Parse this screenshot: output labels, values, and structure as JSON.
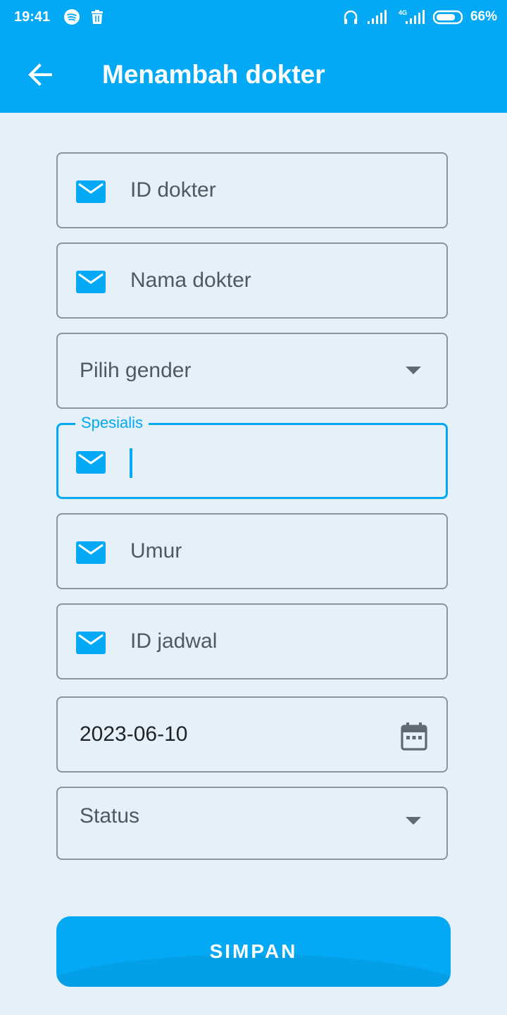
{
  "status_bar": {
    "time": "19:41",
    "battery": "66%",
    "icons": [
      "spotify-icon",
      "trash-icon",
      "headphones-icon",
      "signal-icon",
      "signal-4g-icon",
      "battery-icon"
    ]
  },
  "app_bar": {
    "title": "Menambah dokter",
    "back_icon": "arrow-back-icon",
    "color": "#03a9f4"
  },
  "form": {
    "id_dokter": {
      "placeholder": "ID dokter",
      "icon": "mail-icon"
    },
    "nama_dokter": {
      "placeholder": "Nama dokter",
      "icon": "mail-icon"
    },
    "gender": {
      "placeholder": "Pilih gender",
      "icon": "dropdown-arrow-icon"
    },
    "spesialis": {
      "label": "Spesialis",
      "value": "",
      "icon": "mail-icon",
      "focused": true
    },
    "umur": {
      "placeholder": "Umur",
      "icon": "mail-icon"
    },
    "id_jadwal": {
      "placeholder": "ID jadwal",
      "icon": "mail-icon"
    },
    "tanggal": {
      "value": "2023-06-10",
      "icon": "calendar-icon"
    },
    "status": {
      "placeholder": "Status",
      "icon": "dropdown-arrow-icon"
    }
  },
  "submit": {
    "label": "SIMPAN"
  }
}
